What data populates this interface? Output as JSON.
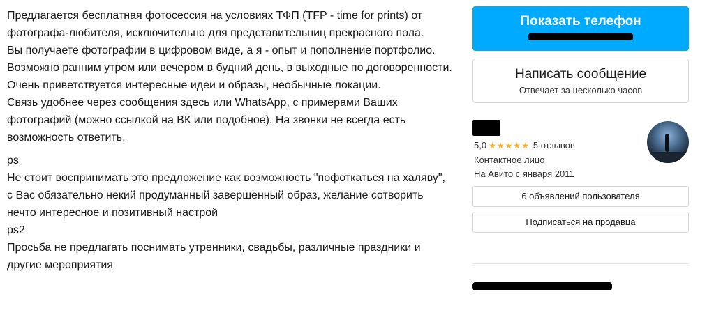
{
  "description": {
    "paragraphs": [
      "Предлагается бесплатная фотосессия на условиях ТФП (TFP - time for prints) от фотографа-любителя, исключительно для представительниц прекрасного пола.",
      "Вы получаете фотографии в цифровом виде, а я - опыт и пополнение портфолио.",
      "Возможно ранним утром или вечером в будний день, в выходные по договоренности.",
      "Очень приветствуется интересные идеи и образы, необычные локации.",
      "Связь удобнее через сообщения здесь или WhatsApp, с примерами Ваших фотографий (можно ссылкой на ВК или подобное). На звонки не всегда есть возможность ответить.",
      "ps",
      "Не стоит воспринимать это предложение как возможность \"пофоткаться на халяву\", с Вас обязательно некий продуманный завершенный образ, желание сотворить нечто интересное и позитивный настрой",
      "ps2",
      "Просьба не предлагать поснимать утренники, свадьбы, различные праздники и другие мероприятия"
    ]
  },
  "sidebar": {
    "show_phone_label": "Показать телефон",
    "write_message_label": "Написать сообщение",
    "response_time": "Отвечает за несколько часов",
    "rating_value": "5,0",
    "rating_stars": "★★★★★",
    "reviews": "5 отзывов",
    "contact_label": "Контактное лицо",
    "member_since": "На Авито с января 2011",
    "listings_button": "6 объявлений пользователя",
    "subscribe_button": "Подписаться на продавца"
  },
  "colors": {
    "accent": "#00aaff",
    "stars": "#ffb021"
  }
}
